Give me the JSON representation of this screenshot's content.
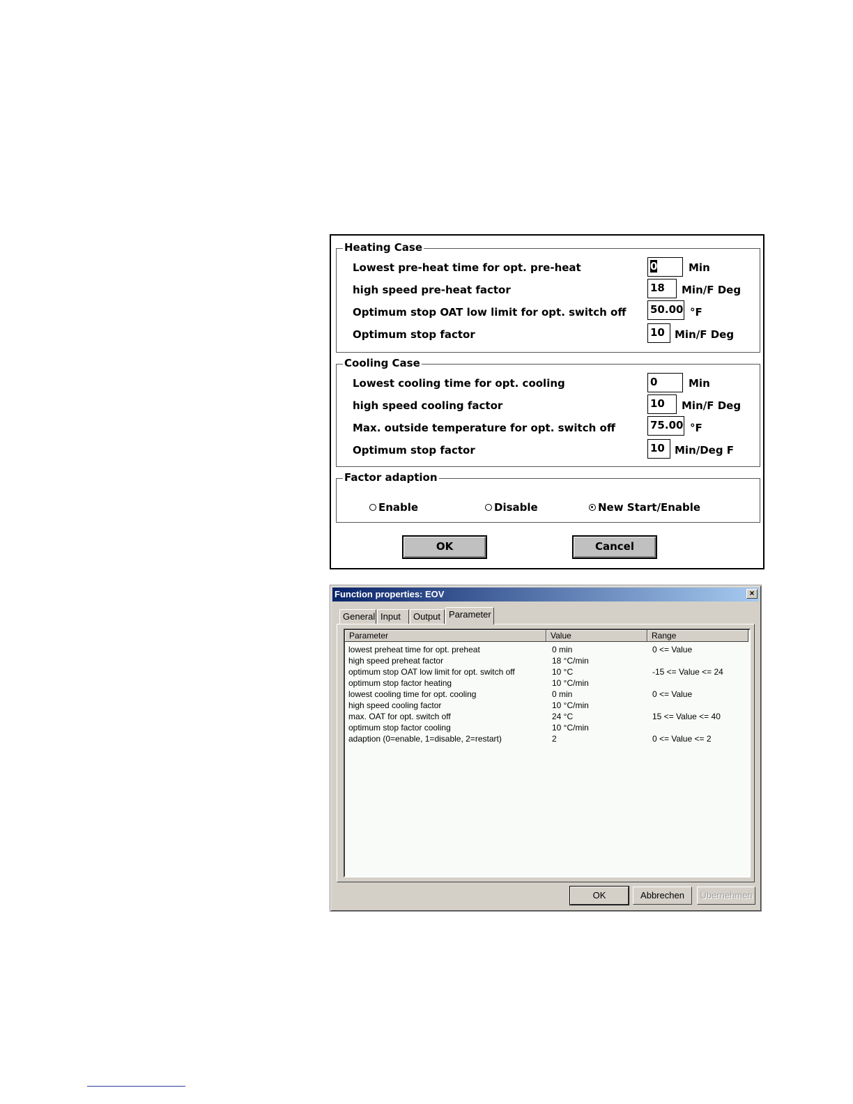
{
  "dialog1": {
    "heating": {
      "title": "Heating Case",
      "rows": [
        {
          "label": "Lowest pre-heat time for opt. pre-heat",
          "value": "0",
          "unit": "Min"
        },
        {
          "label": "high speed pre-heat factor",
          "value": "18",
          "unit": "Min/F Deg"
        },
        {
          "label": "Optimum stop OAT low limit for opt. switch off",
          "value": "50.00",
          "unit": "°F"
        },
        {
          "label": "Optimum stop factor",
          "value": "10",
          "unit": "Min/F Deg"
        }
      ]
    },
    "cooling": {
      "title": "Cooling Case",
      "rows": [
        {
          "label": "Lowest cooling time for opt. cooling",
          "value": "0",
          "unit": "Min"
        },
        {
          "label": "high speed cooling factor",
          "value": "10",
          "unit": "Min/F Deg"
        },
        {
          "label": "Max. outside temperature for opt. switch off",
          "value": "75.00",
          "unit": "°F"
        },
        {
          "label": "Optimum stop factor",
          "value": "10",
          "unit": "Min/Deg F"
        }
      ]
    },
    "adaption": {
      "title": "Factor adaption",
      "options": [
        {
          "label": "Enable",
          "checked": false
        },
        {
          "label": "Disable",
          "checked": false
        },
        {
          "label": "New Start/Enable",
          "checked": true
        }
      ]
    },
    "ok_label": "OK",
    "cancel_label": "Cancel"
  },
  "dialog2": {
    "title": "Function properties: EOV",
    "close_icon": "close-icon",
    "tabs": [
      {
        "label": "General",
        "active": false
      },
      {
        "label": "Input",
        "active": false
      },
      {
        "label": "Output",
        "active": false
      },
      {
        "label": "Parameter",
        "active": true
      }
    ],
    "columns": [
      "Parameter",
      "Value",
      "Range"
    ],
    "rows": [
      [
        "lowest preheat time for opt. preheat",
        "0 min",
        "0 <= Value"
      ],
      [
        "high speed preheat factor",
        "18 °C/min",
        ""
      ],
      [
        "optimum stop OAT low limit for opt. switch off",
        "10 °C",
        "-15 <= Value <= 24"
      ],
      [
        "optimum stop factor heating",
        "10 °C/min",
        ""
      ],
      [
        "lowest cooling time for opt. cooling",
        "0 min",
        "0 <= Value"
      ],
      [
        "high speed cooling factor",
        "10 °C/min",
        ""
      ],
      [
        "max. OAT for opt. switch off",
        "24 °C",
        "15 <= Value <= 40"
      ],
      [
        "optimum stop factor cooling",
        "10 °C/min",
        ""
      ],
      [
        "adaption (0=enable, 1=disable, 2=restart)",
        "2",
        "0 <= Value <= 2"
      ]
    ],
    "ok_label": "OK",
    "cancel_label": "Abbrechen",
    "apply_label": "Übernehmen"
  }
}
